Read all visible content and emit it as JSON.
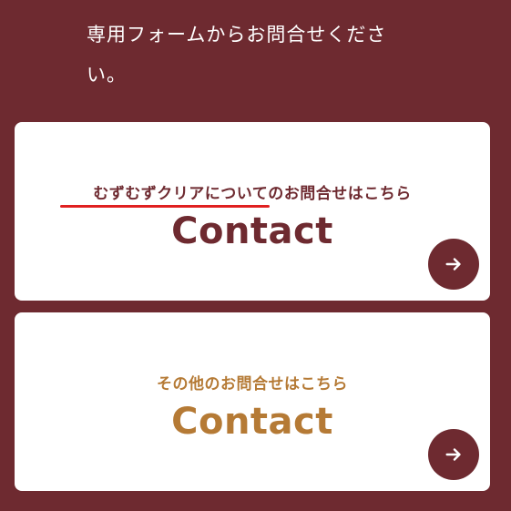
{
  "intro": {
    "text": "専用フォームからお問合せください。"
  },
  "cards": [
    {
      "subtitle": "むずむずクリアについてのお問合せはこちら",
      "title": "Contact",
      "icon": "arrow-right-icon",
      "color": "#6e2a30"
    },
    {
      "subtitle": "その他のお問合せはこちら",
      "title": "Contact",
      "icon": "arrow-right-icon",
      "color": "#b57a35"
    }
  ],
  "colors": {
    "background": "#6e2a30",
    "accent": "#b57a35",
    "underline": "#e02020",
    "card": "#ffffff"
  }
}
